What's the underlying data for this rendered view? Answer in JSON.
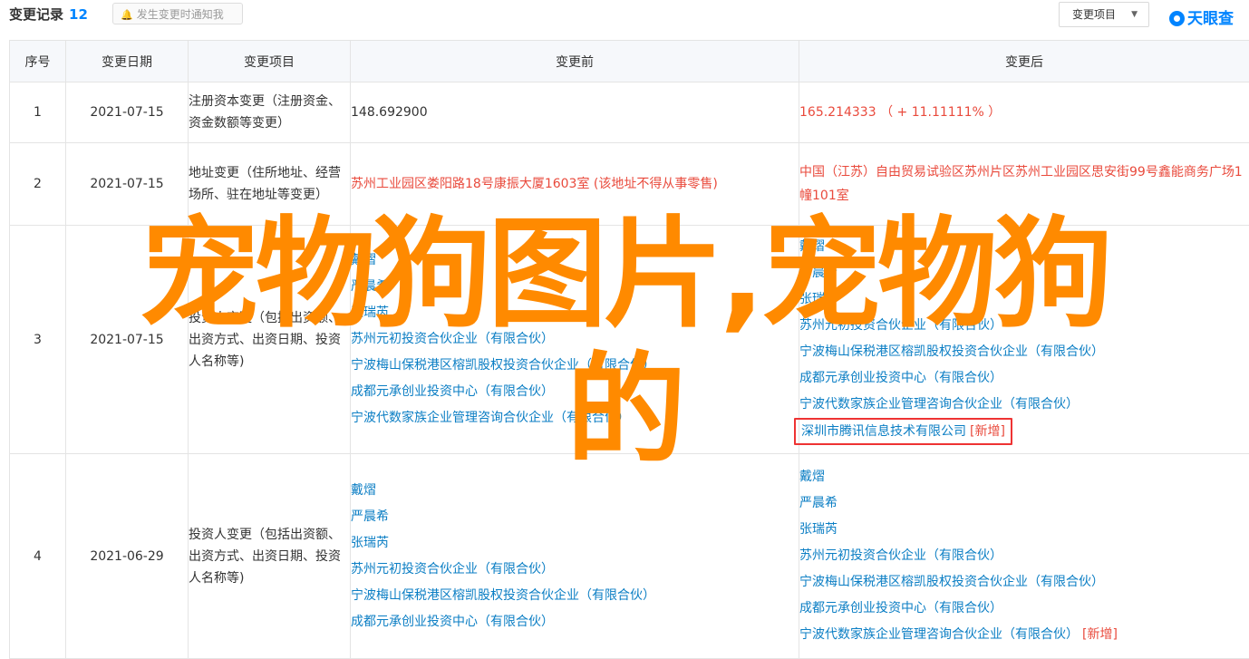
{
  "header": {
    "title": "变更记录",
    "count": "12",
    "notify_label": "发生变更时通知我",
    "filter_label": "变更项目",
    "brand": "天眼查"
  },
  "columns": [
    "序号",
    "变更日期",
    "变更项目",
    "变更前",
    "变更后"
  ],
  "rows": [
    {
      "no": "1",
      "date": "2021-07-15",
      "item": "注册资本变更（注册资金、资金数额等变更）",
      "before": [
        "148.692900"
      ],
      "after": [
        "165.214333 （ + 11.11111% ）"
      ]
    },
    {
      "no": "2",
      "date": "2021-07-15",
      "item": "地址变更（住所地址、经营场所、驻在地址等变更）",
      "before": [
        "苏州工业园区娄阳路18号康振大厦1603室 (该地址不得从事零售)"
      ],
      "after": [
        "中国（江苏）自由贸易试验区苏州片区苏州工业园区思安街99号鑫能商务广场1幢101室"
      ]
    },
    {
      "no": "3",
      "date": "2021-07-15",
      "item": "投资人变更（包括出资额、出资方式、出资日期、投资人名称等)",
      "before": [
        "戴熠",
        "严晨希",
        "张瑞芮",
        "苏州元初投资合伙企业（有限合伙）",
        "宁波梅山保税港区榕凯股权投资合伙企业（有限合伙）",
        "成都元承创业投资中心（有限合伙）",
        "宁波代数家族企业管理咨询合伙企业（有限合伙）"
      ],
      "after": [
        "戴熠",
        "严晨希",
        "张瑞芮",
        "苏州元初投资合伙企业（有限合伙）",
        "宁波梅山保税港区榕凯股权投资合伙企业（有限合伙）",
        "成都元承创业投资中心（有限合伙）",
        "宁波代数家族企业管理咨询合伙企业（有限合伙）",
        "深圳市腾讯信息技术有限公司"
      ],
      "after_new_tag": "[新增]"
    },
    {
      "no": "4",
      "date": "2021-06-29",
      "item": "投资人变更（包括出资额、出资方式、出资日期、投资人名称等)",
      "before": [
        "戴熠",
        "严晨希",
        "张瑞芮",
        "苏州元初投资合伙企业（有限合伙）",
        "宁波梅山保税港区榕凯股权投资合伙企业（有限合伙）",
        "成都元承创业投资中心（有限合伙）"
      ],
      "after": [
        "戴熠",
        "严晨希",
        "张瑞芮",
        "苏州元初投资合伙企业（有限合伙）",
        "宁波梅山保税港区榕凯股权投资合伙企业（有限合伙）",
        "成都元承创业投资中心（有限合伙）",
        "宁波代数家族企业管理咨询合伙企业（有限合伙）"
      ],
      "after_new_tag": "[新增]"
    }
  ],
  "overlay": {
    "line1": "宠物狗图片,宠物狗",
    "line2": "的"
  }
}
